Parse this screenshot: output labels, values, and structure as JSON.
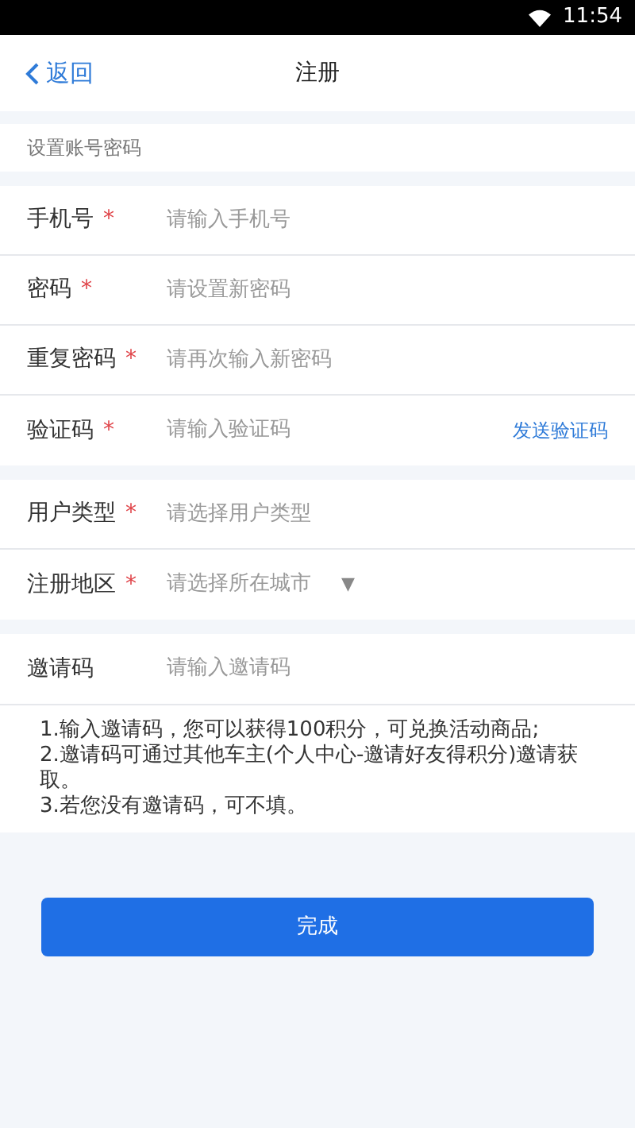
{
  "status_bar": {
    "time": "11:54"
  },
  "header": {
    "back": "返回",
    "title": "注册"
  },
  "section_label": "设置账号密码",
  "groups": [
    {
      "fields": [
        {
          "kind": "input",
          "label": "手机号",
          "mark": "*",
          "placeholder": "请输入手机号"
        },
        {
          "kind": "input",
          "label": "密码",
          "mark": "*",
          "placeholder": "请设置新密码"
        },
        {
          "kind": "input",
          "label": "重复密码",
          "mark": "*",
          "placeholder": "请再次输入新密码"
        },
        {
          "kind": "input",
          "label": "验证码",
          "mark": "*",
          "placeholder": "请输入验证码",
          "action": "发送验证码"
        }
      ]
    },
    {
      "fields": [
        {
          "kind": "select",
          "label": "用户类型",
          "mark": "*",
          "placeholder": "请选择用户类型"
        },
        {
          "kind": "select",
          "label": "注册地区",
          "mark": "*",
          "placeholder": "请选择所在城市",
          "arrow": "▼"
        }
      ]
    },
    {
      "fields": [
        {
          "kind": "input",
          "label": "邀请码",
          "placeholder": "请输入邀请码"
        }
      ]
    }
  ],
  "notes": [
    "1.输入邀请码，您可以获得100积分，可兑换活动商品;",
    "2.邀请码可通过其他车主(个人中心-邀请好友得积分)邀请获取。",
    "3.若您没有邀请码，可不填。"
  ],
  "submit": "完成"
}
